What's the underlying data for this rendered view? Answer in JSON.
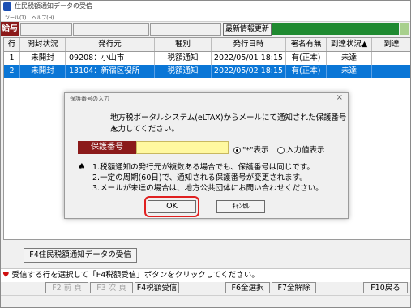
{
  "window": {
    "title": "住民税額通知データの受信",
    "menu": [
      "ツール(T)",
      "ヘルプ(H)"
    ]
  },
  "toolbar": {
    "section_label": "給与",
    "latest_button": "最新情報更新"
  },
  "grid": {
    "headers": [
      "行",
      "開封状況",
      "発行元",
      "種別",
      "発行日時",
      "署名有無",
      "到達状況▲",
      "到達"
    ],
    "rows": [
      [
        "1",
        "未開封",
        "09208：小山市",
        "税額通知",
        "2022/05/01 18:15",
        "有(正本)",
        "未達"
      ],
      [
        "2",
        "未開封",
        "13104：新宿区役所",
        "税額通知",
        "2022/05/02 18:15",
        "有(正本)",
        "未達"
      ]
    ],
    "selected_row": 2
  },
  "receive_button": "F4住民税額通知データの受信",
  "status_message": "受信する行を選択して「F4税額受信」ボタンをクリックしてください。",
  "fkeys": [
    {
      "label": "F2 前 頁",
      "enabled": false
    },
    {
      "label": "F3 次 頁",
      "enabled": false
    },
    {
      "label": "F4税額受信",
      "enabled": true
    },
    {
      "label": "F6全選択",
      "enabled": true
    },
    {
      "label": "F7全解除",
      "enabled": true
    },
    {
      "label": "F10戻る",
      "enabled": true
    }
  ],
  "dialog": {
    "title": "保護番号の入力",
    "message_line1": "地方税ポータルシステム(eLTAX)からメールにて通知された保護番号を",
    "message_line2": "入力してください。",
    "field_label": "保護番号",
    "field_value": "",
    "radio_mask": "\"*\"表示",
    "radio_show": "入力値表示",
    "radio_selected": "mask",
    "notes": [
      "1.税額通知の発行元が複数ある場合でも、保護番号は同じです。",
      "2.一定の周期(60日)で、通知される保護番号が変更されます。",
      "3.メールが未達の場合は、地方公共団体にお問い合わせください。"
    ],
    "ok_label": "OK",
    "cancel_label": "ｷｬﾝｾﾙ"
  },
  "colors": {
    "accent_red": "#8b1a1a",
    "selection_blue": "#0a76d6",
    "status_green": "#1f8a30",
    "input_yellow": "#fff8a0",
    "highlight_ring": "#e02020"
  }
}
